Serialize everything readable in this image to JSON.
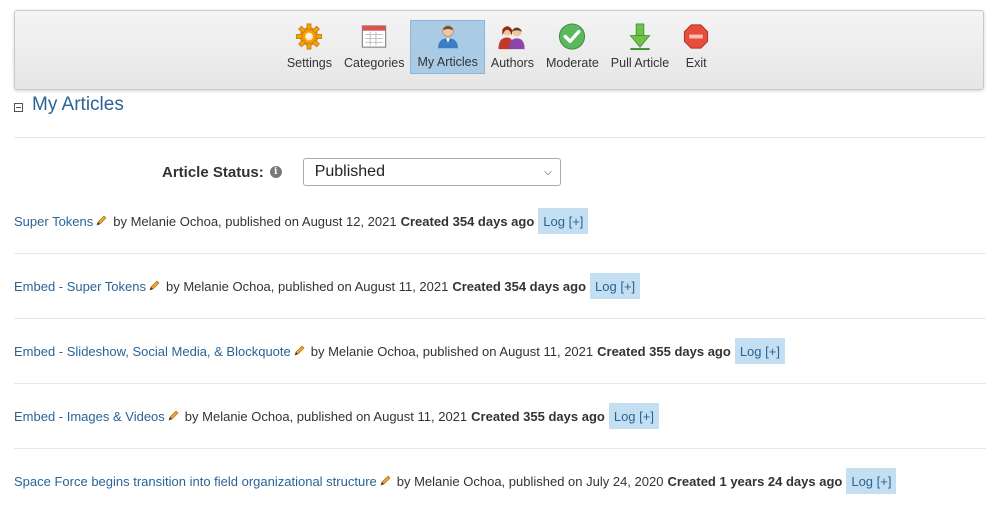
{
  "toolbar": {
    "items": [
      {
        "label": "Settings",
        "icon": "gear-icon"
      },
      {
        "label": "Categories",
        "icon": "calendar-icon"
      },
      {
        "label": "My Articles",
        "icon": "user-icon"
      },
      {
        "label": "Authors",
        "icon": "authors-icon"
      },
      {
        "label": "Moderate",
        "icon": "checkmark-icon"
      },
      {
        "label": "Pull Article",
        "icon": "arrow-down-icon"
      },
      {
        "label": "Exit",
        "icon": "stop-icon"
      }
    ],
    "active": "My Articles"
  },
  "section": {
    "title": "My Articles"
  },
  "filter": {
    "label": "Article Status:",
    "selected": "Published"
  },
  "articles": [
    {
      "title": "Super Tokens",
      "meta": "by Melanie Ochoa, published on August 12, 2021",
      "created": "Created 354 days ago",
      "log": "Log [+]"
    },
    {
      "title": "Embed - Super Tokens",
      "meta": "by Melanie Ochoa, published on August 11, 2021",
      "created": "Created 354 days ago",
      "log": "Log [+]"
    },
    {
      "title": "Embed - Slideshow, Social Media, & Blockquote",
      "meta": "by Melanie Ochoa, published on August 11, 2021",
      "created": "Created 355 days ago",
      "log": "Log [+]"
    },
    {
      "title": "Embed - Images & Videos",
      "meta": "by Melanie Ochoa, published on August 11, 2021",
      "created": "Created 355 days ago",
      "log": "Log [+]"
    },
    {
      "title": "Space Force begins transition into field organizational structure",
      "meta": "by Melanie Ochoa, published on July 24, 2020",
      "created": "Created 1 years 24 days ago",
      "log": "Log [+]"
    }
  ],
  "colors": {
    "link": "#2a6496",
    "log_bg": "#c4dff1",
    "active_tab": "#a9cbe6"
  }
}
